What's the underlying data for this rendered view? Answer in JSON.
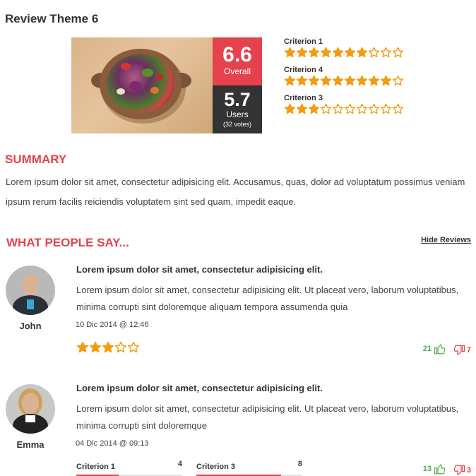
{
  "page": {
    "title": "Review Theme 6"
  },
  "hero": {
    "overall": {
      "score": "6.6",
      "label": "Overall"
    },
    "users": {
      "score": "5.7",
      "label": "Users",
      "votes": "(32 votes)"
    },
    "criteria": [
      {
        "label": "Criterion 1",
        "rating": 7
      },
      {
        "label": "Criterion 4",
        "rating": 9
      },
      {
        "label": "Criterion 3",
        "rating": 3
      }
    ],
    "criteria_star_count": 10
  },
  "summary": {
    "heading": "SUMMARY",
    "text": "Lorem ipsum dolor sit amet, consectetur adipisicing elit. Accusamus, quas, dolor ad voluptatum possimus veniam ipsum rerum facilis reiciendis voluptatem sint sed quam, impedit eaque."
  },
  "reviews_section": {
    "heading": "WHAT PEOPLE SAY...",
    "hide_label": "Hide Reviews"
  },
  "reviews": [
    {
      "author": "John",
      "title": "Lorem ipsum dolor sit amet, consectetur adipisicing elit.",
      "body": "Lorem ipsum dolor sit amet, consectetur adipisicing elit. Ut placeat vero, laborum voluptatibus, minima corrupti sint doloremque aliquam tempora assumenda quia",
      "date": "10 Dic 2014 @ 12:46",
      "rating": 3,
      "rating_max": 5,
      "likes": "21",
      "dislikes": "7"
    },
    {
      "author": "Emma",
      "title": "Lorem ipsum dolor sit amet, consectetur adipisicing elit.",
      "body": "Lorem ipsum dolor sit amet, consectetur adipisicing elit. Ut placeat vero, laborum voluptatibus, minima corrupti sint doloremque",
      "date": "04 Dic 2014 @ 09:13",
      "criteria": [
        {
          "label": "Criterion 1",
          "value": "4",
          "fraction": 0.4
        },
        {
          "label": "Criterion 3",
          "value": "8",
          "fraction": 0.8
        }
      ],
      "likes": "13",
      "dislikes": "3"
    }
  ],
  "colors": {
    "accent": "#e4424d",
    "star": "#f39c12",
    "dark": "#333333",
    "like": "#4caf50"
  }
}
